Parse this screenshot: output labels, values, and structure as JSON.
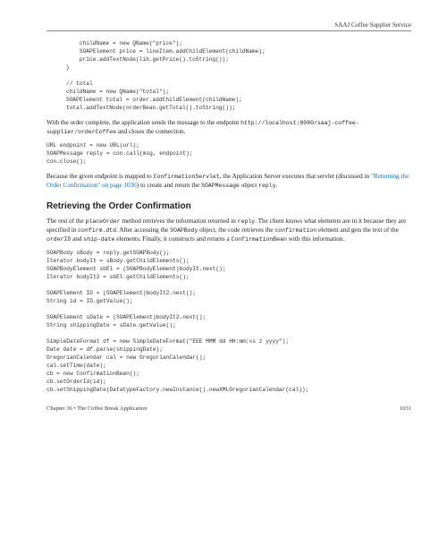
{
  "header": {
    "title": "SAAJ Coffee Supplier Service"
  },
  "code1": "    childName = new QName(\"price\");\n    SOAPElement price = lineItem.addChildElement(childName);\n    price.addTextNode(lib.getPrice().toString());\n}\n\n// total\nchildName = new QName(\"total\");\nSOAPElement total = order.addChildElement(childName);\ntotal.addTextNode(orderBean.getTotal().toString());",
  "para1_a": "With the order complete, the application sends the message to the endpoint ",
  "para1_b": "http://localhost:8080/saaj-coffee-supplier/orderCoffee",
  "para1_c": " and closes the connection.",
  "code2": "URL endpoint = new URL(url);\nSOAPMessage reply = con.call(msg, endpoint);\ncon.close();",
  "para2_a": "Because the given endpoint is mapped to ",
  "para2_b": "ConfirmationServlet",
  "para2_c": ", the Application Server executes that servlet (discussed in ",
  "para2_link": "\"Returning the Order Confirmation\" on page 1036",
  "para2_d": ") to create and return the ",
  "para2_e": "SOAPMessage",
  "para2_f": " object ",
  "para2_g": "reply",
  "para2_h": ".",
  "section": "Retrieving the Order Confirmation",
  "para3_a": "The rest of the ",
  "para3_b": "placeOrder",
  "para3_c": " method retrieves the information returned in ",
  "para3_d": "reply",
  "para3_e": ". The client knows what elements are in it because they are specified in ",
  "para3_f": "confirm.dtd",
  "para3_g": ". After accessing the ",
  "para3_h": "SOAPBody",
  "para3_i": " object, the code retrieves the ",
  "para3_j": "confirmation",
  "para3_k": " element and gets the text of the ",
  "para3_l": "orderID",
  "para3_m": " and ",
  "para3_n": "ship-date",
  "para3_o": " elements. Finally, it constructs and returns a ",
  "para3_p": "ConfirmationBean",
  "para3_q": " with this information.",
  "code3": "SOAPBody sBody = reply.getSOAPBody();\nIterator bodyIt = sBody.getChildElements();\nSOAPBodyElement sbEl = (SOAPBodyElement)bodyIt.next();\nIterator bodyIt2 = sbEl.getChildElements();\n\nSOAPElement ID = (SOAPElement)bodyIt2.next();\nString id = ID.getValue();\n\nSOAPElement sDate = (SOAPElement)bodyIt2.next();\nString shippingDate = sDate.getValue();\n\nSimpleDateFormat df = new SimpleDateFormat(\"EEE MMM dd HH:mm:ss z yyyy\");\nDate date = df.parse(shippingDate);\nGregorianCalendar cal = new GregorianCalendar();\ncal.setTime(date);\ncb = new ConfirmationBean();\ncb.setOrderId(id);\ncb.setShippingDate(DatatypeFactory.newInstance().newXMLGregorianCalendar(cal));",
  "footer": {
    "left": "Chapter 36 • The Coffee Break Application",
    "right": "1031"
  }
}
